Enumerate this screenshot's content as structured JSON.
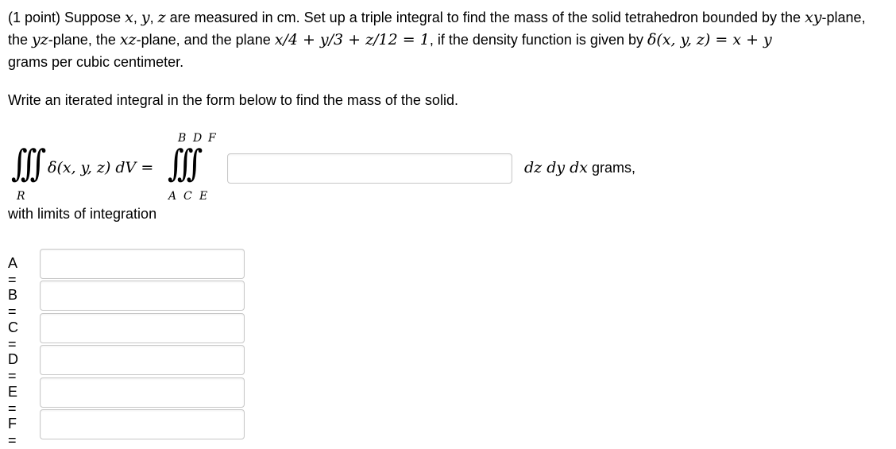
{
  "problem": {
    "p1": "(1 point) Suppose ",
    "v_x": "x",
    "c1": ", ",
    "v_y": "y",
    "c2": ", ",
    "v_z": "z",
    "p2": " are measured in cm. Set up a triple integral to find the mass of the solid tetrahedron bounded by the ",
    "v_xy": "xy",
    "p3": "-plane, the ",
    "v_yz": "yz",
    "p4": "-plane, the ",
    "v_xz": "xz",
    "p5": "-plane, and the plane ",
    "plane_eq": "x/4 + y/3 + z/12 = 1",
    "p6": ", if the density function is given by ",
    "density_lhs": "δ(x, y, z)",
    "density_eq": " = x + y",
    "p7": "grams per cubic centimeter."
  },
  "instruction": "Write an iterated integral in the form below to find the mass of the solid.",
  "integral": {
    "region_label": "R",
    "integrand": "δ(x, y, z) dV",
    "equals": "=",
    "upper_limits": [
      "B",
      "D",
      "F"
    ],
    "lower_limits": [
      "A",
      "C",
      "E"
    ],
    "differentials": "dz dy dx",
    "units": " grams,",
    "integrand_input": {
      "value": "",
      "placeholder": ""
    }
  },
  "with_limits_label": "with limits of integration",
  "limits": [
    {
      "label": "A =",
      "value": ""
    },
    {
      "label": "B =",
      "value": ""
    },
    {
      "label": "C =",
      "value": ""
    },
    {
      "label": "D =",
      "value": ""
    },
    {
      "label": "E =",
      "value": ""
    },
    {
      "label": "F =",
      "value": ""
    }
  ]
}
